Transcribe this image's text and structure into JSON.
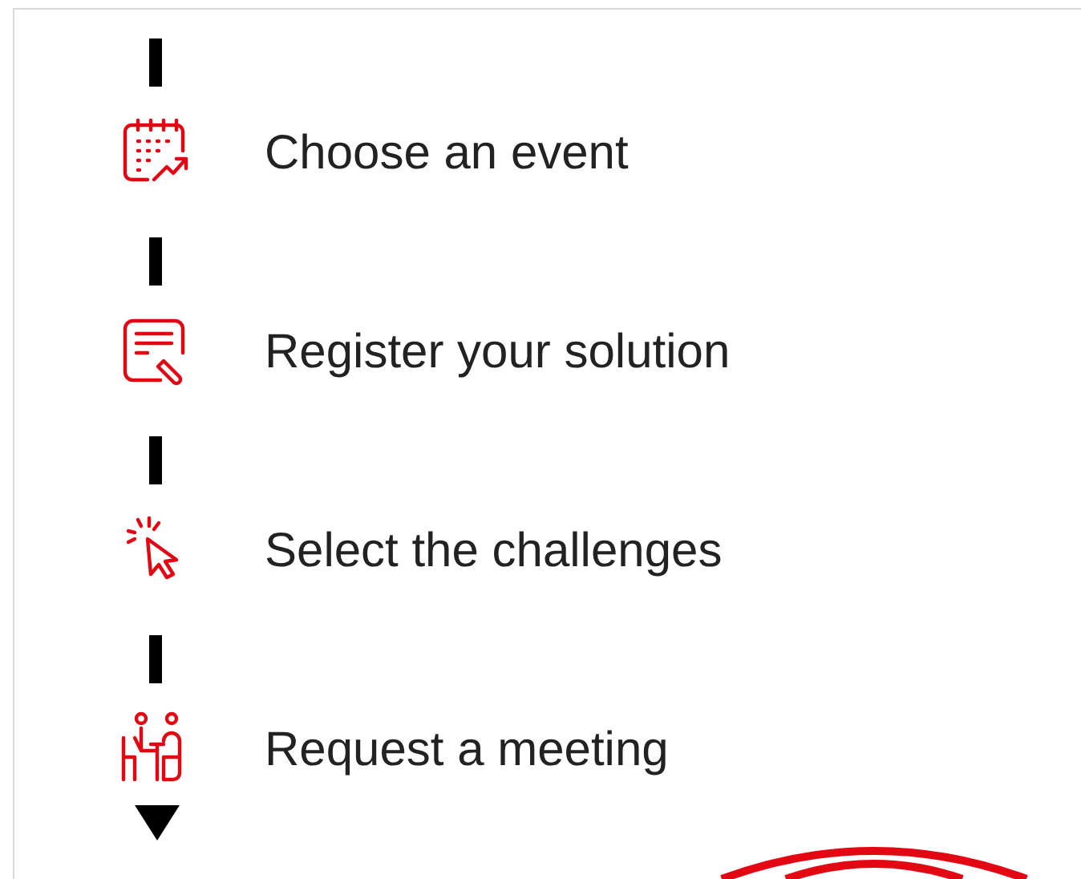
{
  "steps": [
    {
      "kind": "calendar",
      "label": "Choose an event"
    },
    {
      "kind": "form",
      "label": "Register your solution"
    },
    {
      "kind": "click",
      "label": "Select the challenges"
    },
    {
      "kind": "meeting",
      "label": "Request a meeting"
    }
  ]
}
